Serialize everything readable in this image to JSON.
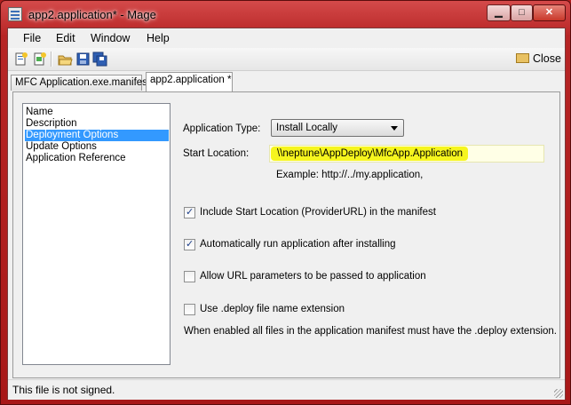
{
  "window": {
    "title": "app2.application* - Mage",
    "minimize_label": "▁",
    "maximize_label": "□",
    "close_label": "✕"
  },
  "menu": [
    "File",
    "Edit",
    "Window",
    "Help"
  ],
  "toolbar": {
    "buttons": [
      "new-manifest-icon",
      "new-application-icon",
      "open-icon",
      "save-icon",
      "save-all-icon"
    ],
    "close_label": "Close"
  },
  "tabs": [
    "MFC Application.exe.manifest",
    "app2.application *"
  ],
  "nav": {
    "items": [
      "Name",
      "Description",
      "Deployment Options",
      "Update Options",
      "Application Reference"
    ],
    "selected_index": 2
  },
  "form": {
    "application_type_label": "Application Type:",
    "application_type_value": "Install Locally",
    "start_location_label": "Start Location:",
    "start_location_value": "\\\\neptune\\AppDeploy\\MfcApp.Application",
    "example_text": "Example: http://../my.application,",
    "checkboxes": [
      {
        "label": "Include Start Location (ProviderURL) in the manifest",
        "checked": true
      },
      {
        "label": "Automatically run application after installing",
        "checked": true
      },
      {
        "label": "Allow URL parameters to be passed to application",
        "checked": false
      },
      {
        "label": "Use .deploy file name extension",
        "checked": false
      }
    ],
    "note": "When enabled all files in the application manifest must have the .deploy extension."
  },
  "status": {
    "text": "This file is not signed."
  },
  "colors": {
    "title_bar": "#b72525",
    "selection": "#3399ff",
    "highlight": "#f6f51e"
  }
}
